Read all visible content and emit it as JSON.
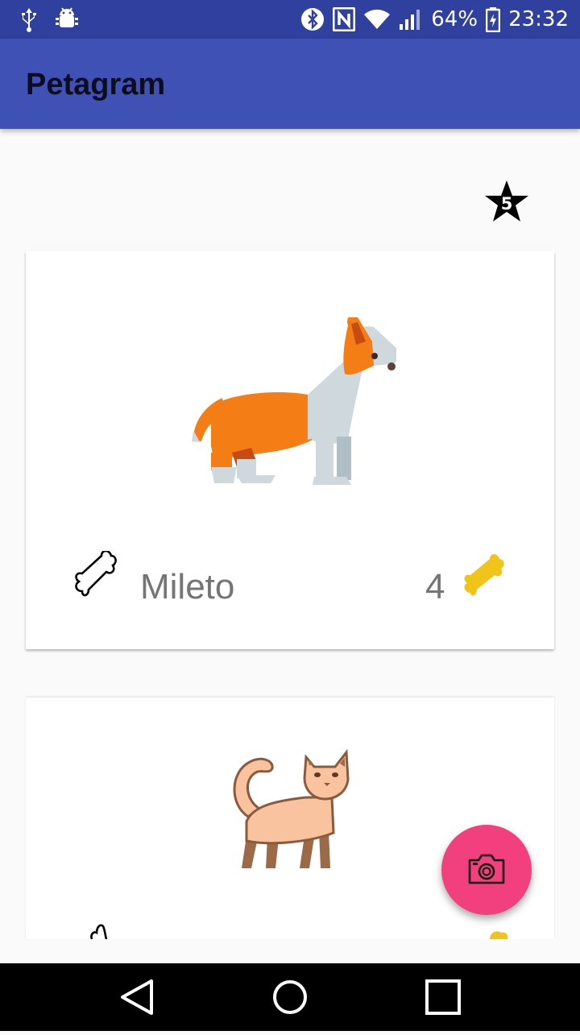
{
  "status_bar": {
    "battery": "64%",
    "time": "23:32",
    "icons": [
      "usb-icon",
      "android-debug-icon",
      "bluetooth-icon",
      "nfc-icon",
      "wifi-icon",
      "cell-signal-icon",
      "battery-charging-icon"
    ]
  },
  "app_bar": {
    "title": "Petagram"
  },
  "favorites": {
    "count": "5",
    "icon": "star-icon"
  },
  "pets": [
    {
      "name": "Mileto",
      "likes": "4",
      "image": "corgi-dog"
    },
    {
      "name": "",
      "likes": "",
      "image": "cat"
    }
  ],
  "fab": {
    "icon": "camera-icon",
    "color": "#f2407e"
  },
  "colors": {
    "primary": "#3f51b5",
    "primary_dark": "#30409f",
    "accent": "#f2407e",
    "bone_yellow": "#f0c419"
  },
  "nav_bar": {
    "buttons": [
      "back",
      "home",
      "recents"
    ]
  }
}
